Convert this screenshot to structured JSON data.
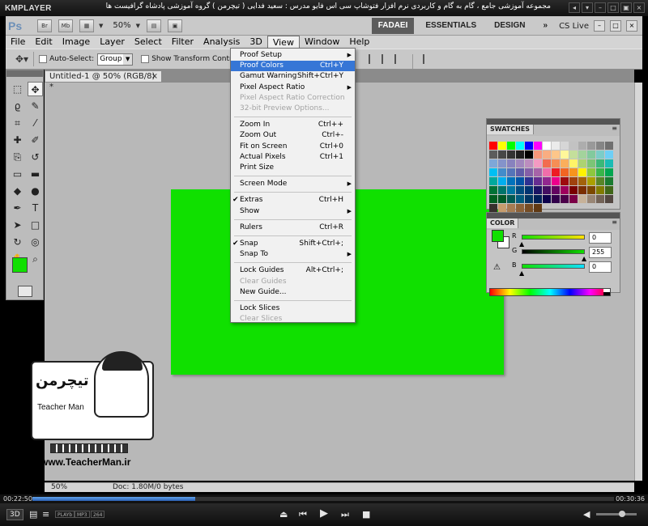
{
  "player": {
    "name": "KMPLAYER",
    "title": "مجموعه آموزشی جامع ، گام به گام و کاربردی نرم افزار فتوشاپ سی اس فایو  مدرس : سعید فدایی ( تیچرمن ) گروه آموزشی پادشاه گرافیست ها",
    "elapsed": "00:22:50",
    "total": "00:30:36",
    "progress": 0.28,
    "tags": [
      "3D",
      "PLAYb",
      "MP3",
      "264"
    ],
    "volume": 0.7
  },
  "appbar": {
    "logo": "Ps",
    "bridge": "Br",
    "minibridge": "Mb",
    "zoom": "50%",
    "workspaces": [
      "FADAEI",
      "ESSENTIALS",
      "DESIGN"
    ],
    "active_workspace": "FADAEI",
    "more": "»",
    "cs_live": "CS Live",
    "window_buttons": [
      "–",
      "□",
      "×"
    ]
  },
  "menubar": [
    "File",
    "Edit",
    "Image",
    "Layer",
    "Select",
    "Filter",
    "Analysis",
    "3D",
    "View",
    "Window",
    "Help"
  ],
  "open_menu": "View",
  "options": {
    "auto_select_label": "Auto-Select:",
    "auto_select_value": "Group",
    "show_transform_label": "Show Transform Controls"
  },
  "document": {
    "tab_label": "Untitled-1 @ 50% (RGB/8) *",
    "canvas_color": "#10e000",
    "status_zoom": "50%",
    "status_doc": "Doc: 1.80M/0 bytes"
  },
  "tools": {
    "icons": [
      "rect-marquee-icon",
      "move-icon",
      "lasso-icon",
      "quick-select-icon",
      "crop-icon",
      "eyedropper-icon",
      "healing-icon",
      "brush-icon",
      "clone-stamp-icon",
      "history-brush-icon",
      "eraser-icon",
      "gradient-icon",
      "blur-icon",
      "dodge-icon",
      "pen-icon",
      "type-icon",
      "path-select-icon",
      "shape-icon",
      "3d-rotate-icon",
      "3d-orbit-icon",
      "hand-icon",
      "zoom-icon"
    ],
    "glyphs": [
      "⬚",
      "✥",
      "ϱ",
      "✎",
      "⌗",
      "⁄",
      "✚",
      "✐",
      "⎘",
      "↺",
      "▭",
      "▬",
      "◆",
      "●",
      "✒",
      "T",
      "➤",
      "□",
      "↻",
      "◎",
      "✋",
      "⌕"
    ],
    "foreground": "#10e000",
    "background": "#ffffff"
  },
  "view_menu": [
    {
      "label": "Proof Setup",
      "shortcut": "",
      "submenu": true,
      "disabled": false,
      "checked": false,
      "highlighted": false
    },
    {
      "label": "Proof Colors",
      "shortcut": "Ctrl+Y",
      "submenu": false,
      "disabled": false,
      "checked": false,
      "highlighted": true
    },
    {
      "label": "Gamut Warning",
      "shortcut": "Shift+Ctrl+Y",
      "submenu": false,
      "disabled": false,
      "checked": false,
      "highlighted": false
    },
    {
      "label": "Pixel Aspect Ratio",
      "shortcut": "",
      "submenu": true,
      "disabled": false,
      "checked": false,
      "highlighted": false
    },
    {
      "label": "Pixel Aspect Ratio Correction",
      "shortcut": "",
      "submenu": false,
      "disabled": true,
      "checked": false,
      "highlighted": false
    },
    {
      "label": "32-bit Preview Options...",
      "shortcut": "",
      "submenu": false,
      "disabled": true,
      "checked": false,
      "highlighted": false
    },
    {
      "sep": true
    },
    {
      "label": "Zoom In",
      "shortcut": "Ctrl++",
      "submenu": false,
      "disabled": false,
      "checked": false,
      "highlighted": false
    },
    {
      "label": "Zoom Out",
      "shortcut": "Ctrl+-",
      "submenu": false,
      "disabled": false,
      "checked": false,
      "highlighted": false
    },
    {
      "label": "Fit on Screen",
      "shortcut": "Ctrl+0",
      "submenu": false,
      "disabled": false,
      "checked": false,
      "highlighted": false
    },
    {
      "label": "Actual Pixels",
      "shortcut": "Ctrl+1",
      "submenu": false,
      "disabled": false,
      "checked": false,
      "highlighted": false
    },
    {
      "label": "Print Size",
      "shortcut": "",
      "submenu": false,
      "disabled": false,
      "checked": false,
      "highlighted": false
    },
    {
      "sep": true
    },
    {
      "label": "Screen Mode",
      "shortcut": "",
      "submenu": true,
      "disabled": false,
      "checked": false,
      "highlighted": false
    },
    {
      "sep": true
    },
    {
      "label": "Extras",
      "shortcut": "Ctrl+H",
      "submenu": false,
      "disabled": false,
      "checked": true,
      "highlighted": false
    },
    {
      "label": "Show",
      "shortcut": "",
      "submenu": true,
      "disabled": false,
      "checked": false,
      "highlighted": false
    },
    {
      "sep": true
    },
    {
      "label": "Rulers",
      "shortcut": "Ctrl+R",
      "submenu": false,
      "disabled": false,
      "checked": false,
      "highlighted": false
    },
    {
      "sep": true
    },
    {
      "label": "Snap",
      "shortcut": "Shift+Ctrl+;",
      "submenu": false,
      "disabled": false,
      "checked": true,
      "highlighted": false
    },
    {
      "label": "Snap To",
      "shortcut": "",
      "submenu": true,
      "disabled": false,
      "checked": false,
      "highlighted": false
    },
    {
      "sep": true
    },
    {
      "label": "Lock Guides",
      "shortcut": "Alt+Ctrl+;",
      "submenu": false,
      "disabled": false,
      "checked": false,
      "highlighted": false
    },
    {
      "label": "Clear Guides",
      "shortcut": "",
      "submenu": false,
      "disabled": true,
      "checked": false,
      "highlighted": false
    },
    {
      "label": "New Guide...",
      "shortcut": "",
      "submenu": false,
      "disabled": false,
      "checked": false,
      "highlighted": false
    },
    {
      "sep": true
    },
    {
      "label": "Lock Slices",
      "shortcut": "",
      "submenu": false,
      "disabled": false,
      "checked": false,
      "highlighted": false
    },
    {
      "label": "Clear Slices",
      "shortcut": "",
      "submenu": false,
      "disabled": true,
      "checked": false,
      "highlighted": false
    }
  ],
  "swatches": {
    "title": "SWATCHES",
    "colors": [
      "#ff0000",
      "#ffff00",
      "#00ff00",
      "#00ffff",
      "#0000ff",
      "#ff00ff",
      "#ffffff",
      "#ebebeb",
      "#d6d6d6",
      "#c2c2c2",
      "#adadad",
      "#999999",
      "#858585",
      "#707070",
      "#5c5c5c",
      "#474747",
      "#333333",
      "#1f1f1f",
      "#000000",
      "#f7977a",
      "#f9ad81",
      "#fdc68a",
      "#fff79a",
      "#c4df9b",
      "#a3d39c",
      "#82ca9d",
      "#7bcdc8",
      "#6ecff6",
      "#7ea7d8",
      "#8493ca",
      "#8882be",
      "#a187be",
      "#bc8dbf",
      "#f49ac2",
      "#f26c4f",
      "#f68e55",
      "#fbaf5c",
      "#fff467",
      "#acd372",
      "#7cc576",
      "#3bb878",
      "#1abbb4",
      "#00bff3",
      "#438cca",
      "#5574b9",
      "#605ca8",
      "#855fa8",
      "#a763a8",
      "#f06eaa",
      "#ed1c24",
      "#f26522",
      "#f7941d",
      "#fff200",
      "#8dc73f",
      "#39b54a",
      "#00a651",
      "#00a99d",
      "#00aeef",
      "#0072bc",
      "#0054a6",
      "#2e3192",
      "#662d91",
      "#92278f",
      "#ec008c",
      "#9e0b0f",
      "#a0410d",
      "#a3620a",
      "#aba000",
      "#598527",
      "#1a7b30",
      "#007236",
      "#00746b",
      "#0076a3",
      "#004b80",
      "#003471",
      "#1b1464",
      "#440e62",
      "#630460",
      "#9e005d",
      "#790000",
      "#7b2e00",
      "#7d4900",
      "#827b00",
      "#406618",
      "#005e20",
      "#005826",
      "#005952",
      "#005b7f",
      "#003663",
      "#002157",
      "#0d004c",
      "#32004b",
      "#4b0049",
      "#7b0046",
      "#c7b299",
      "#998675",
      "#736357",
      "#534741",
      "#37302d",
      "#c69c6d",
      "#a67c52",
      "#8c6239",
      "#754c24",
      "#603913"
    ]
  },
  "color_panel": {
    "title": "COLOR",
    "channels": [
      {
        "name": "R",
        "value": "0"
      },
      {
        "name": "G",
        "value": "255"
      },
      {
        "name": "B",
        "value": "0"
      }
    ]
  },
  "watermark": {
    "logo_text": "تیچرمن",
    "name": "Teacher Man",
    "url": "www.TeacherMan.ir"
  }
}
